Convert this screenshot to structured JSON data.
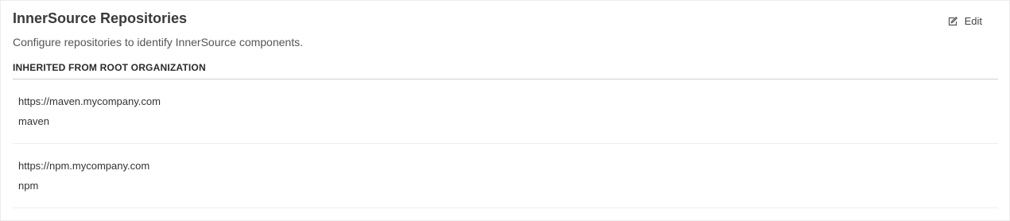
{
  "panel": {
    "title": "InnerSource Repositories",
    "subtitle": "Configure repositories to identify InnerSource components.",
    "edit_label": "Edit",
    "edit_icon": "edit-icon"
  },
  "section": {
    "heading": "INHERITED FROM ROOT ORGANIZATION"
  },
  "repositories": [
    {
      "url": "https://maven.mycompany.com",
      "type": "maven"
    },
    {
      "url": "https://npm.mycompany.com",
      "type": "npm"
    }
  ]
}
